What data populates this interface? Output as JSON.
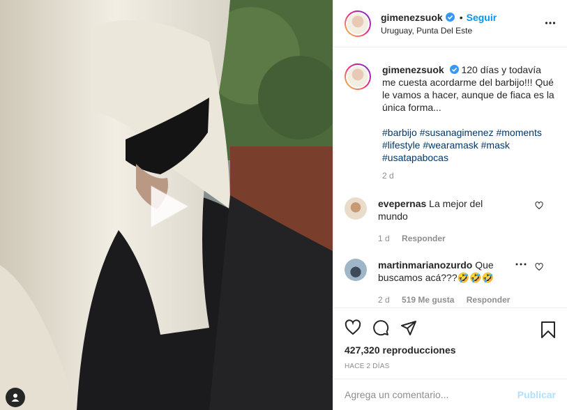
{
  "header": {
    "username": "gimenezsuok",
    "follow_label": "Seguir",
    "separator": "•",
    "location": "Uruguay, Punta Del Este"
  },
  "caption": {
    "username": "gimenezsuok",
    "text": "120 días y todavía me cuesta acordarme del barbijo!!! Qué le vamos a hacer, aunque de fiaca es la única forma...",
    "hashtags": [
      "#barbijo",
      "#susanagimenez",
      "#moments",
      "#lifestyle",
      "#wearamask",
      "#mask",
      "#usatapabocas"
    ],
    "time": "2 d"
  },
  "comments": [
    {
      "username": "evepernas",
      "text": "La mejor del mundo",
      "time": "1 d",
      "likes": "",
      "reply": "Responder"
    },
    {
      "username": "martinmarianozurdo",
      "text": "Que buscamos acá???🤣🤣🤣",
      "time": "2 d",
      "likes": "519 Me gusta",
      "reply": "Responder"
    }
  ],
  "actions": {
    "views": "427,320 reproducciones",
    "ago": "HACE 2 DÍAS"
  },
  "add_comment": {
    "placeholder": "Agrega un comentario...",
    "publish": "Publicar"
  },
  "colors": {
    "accent": "#0095f6",
    "text": "#262626",
    "muted": "#8e8e8e",
    "hashtag": "#00376b"
  },
  "icons": [
    "verified-icon",
    "more-options-icon",
    "heart-icon",
    "comment-icon",
    "share-icon",
    "bookmark-icon",
    "play-icon",
    "user-tag-icon"
  ]
}
